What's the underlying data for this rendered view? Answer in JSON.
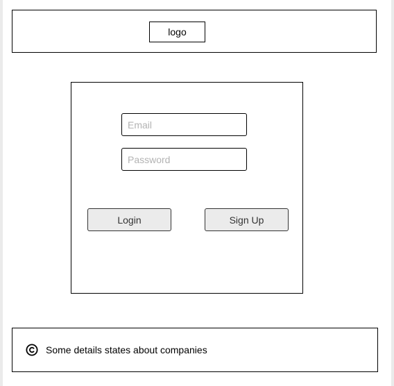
{
  "header": {
    "logo_label": "logo"
  },
  "login_form": {
    "email": {
      "placeholder": "Email",
      "value": ""
    },
    "password": {
      "placeholder": "Password",
      "value": ""
    },
    "login_label": "Login",
    "signup_label": "Sign Up"
  },
  "footer": {
    "icon": "copyright-icon",
    "text": "Some details states about companies"
  }
}
